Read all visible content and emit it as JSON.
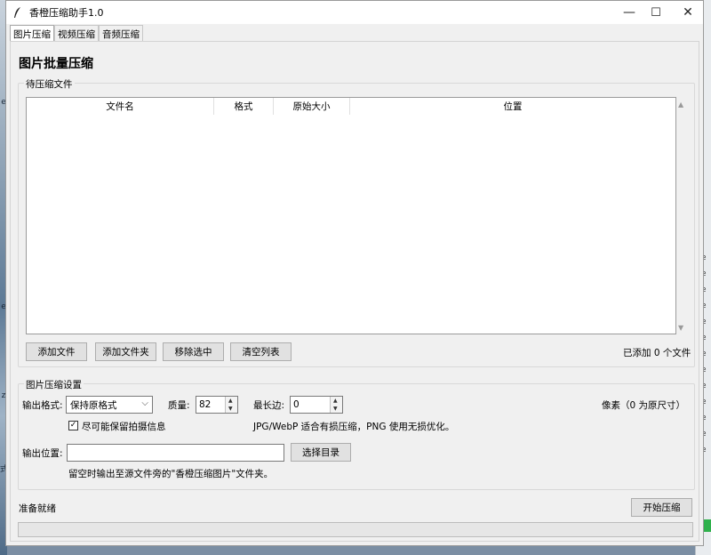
{
  "window": {
    "title": "香橙压缩助手1.0",
    "minimize": "—",
    "maximize": "☐",
    "close": "✕"
  },
  "tabs": [
    "图片压缩",
    "视频压缩",
    "音频压缩"
  ],
  "page": {
    "title": "图片批量压缩"
  },
  "file_list": {
    "group_label": "待压缩文件",
    "columns": [
      "文件名",
      "格式",
      "原始大小",
      "位置"
    ],
    "rows": [],
    "buttons": {
      "add_files": "添加文件",
      "add_folder": "添加文件夹",
      "remove_selected": "移除选中",
      "clear_list": "清空列表"
    },
    "count_text": "已添加 0 个文件"
  },
  "settings": {
    "group_label": "图片压缩设置",
    "output_format_label": "输出格式:",
    "output_format_value": "保持原格式",
    "quality_label": "质量:",
    "quality_value": "82",
    "max_side_label": "最长边:",
    "max_side_value": "0",
    "pixel_hint": "像素（0 为原尺寸）",
    "keep_exif_checked": true,
    "keep_exif_label": "尽可能保留拍摄信息",
    "format_hint": "JPG/WebP 适合有损压缩，PNG 使用无损优化。",
    "output_location_label": "输出位置:",
    "output_location_value": "",
    "choose_dir_button": "选择目录",
    "output_hint": "留空时输出至源文件旁的\"香橙压缩图片\"文件夹。"
  },
  "footer": {
    "status": "准备就绪",
    "start_button": "开始压缩",
    "progress": 0
  }
}
